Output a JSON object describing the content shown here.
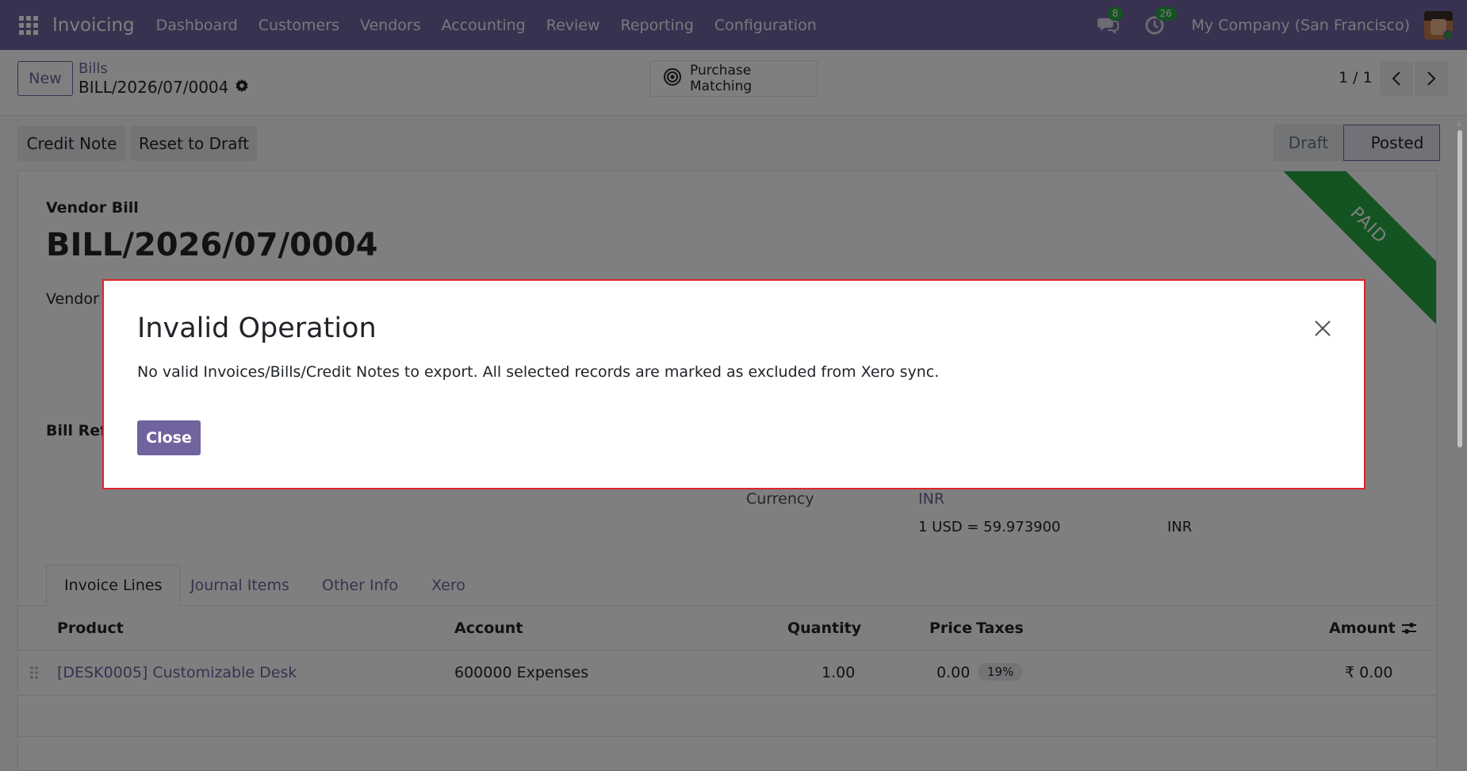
{
  "navbar": {
    "app_name": "Invoicing",
    "menu": [
      "Dashboard",
      "Customers",
      "Vendors",
      "Accounting",
      "Review",
      "Reporting",
      "Configuration"
    ],
    "messages_count": "8",
    "activities_count": "26",
    "company": "My Company (San Francisco)",
    "accent_color": "#71639e"
  },
  "control_panel": {
    "new_label": "New",
    "breadcrumb_parent": "Bills",
    "breadcrumb_current": "BILL/2026/07/0004",
    "purchase_matching_label": "Purchase Matching",
    "pager": "1 / 1"
  },
  "form": {
    "actions": {
      "credit_note": "Credit Note",
      "reset_to_draft": "Reset to Draft"
    },
    "statusbar": {
      "draft": "Draft",
      "posted": "Posted"
    },
    "ribbon": "PAID",
    "doc_type": "Vendor Bill",
    "doc_number": "BILL/2026/07/0004",
    "vendor_label": "Vendor",
    "bill_reference_label": "Bill Refe",
    "currency_label": "Currency",
    "currency_value": "INR",
    "rate_text": "1 USD = 59.973900",
    "rate_currency": "INR",
    "tabs": [
      "Invoice Lines",
      "Journal Items",
      "Other Info",
      "Xero"
    ],
    "lines": {
      "headers": {
        "product": "Product",
        "account": "Account",
        "quantity": "Quantity",
        "price": "Price",
        "taxes": "Taxes",
        "amount": "Amount"
      },
      "rows": [
        {
          "product": "[DESK0005] Customizable Desk",
          "account": "600000 Expenses",
          "quantity": "1.00",
          "price": "0.00",
          "tax": "19%",
          "amount": "₹ 0.00"
        }
      ]
    }
  },
  "dialog": {
    "title": "Invalid Operation",
    "message": "No valid Invoices/Bills/Credit Notes to export. All selected records are marked as excluded from Xero sync.",
    "close_label": "Close"
  }
}
